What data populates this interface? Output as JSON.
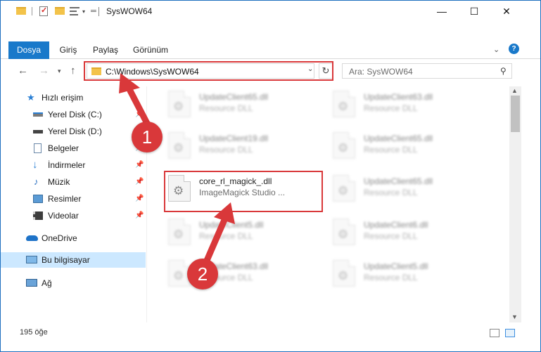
{
  "window": {
    "title": "SysWOW64",
    "controls": {
      "minimize": "—",
      "maximize": "☐",
      "close": "✕"
    }
  },
  "ribbon": {
    "tabs": [
      "Dosya",
      "Giriş",
      "Paylaş",
      "Görünüm"
    ],
    "help": "?"
  },
  "navigation": {
    "address": "C:\\Windows\\SysWOW64",
    "search_placeholder": "Ara: SysWOW64"
  },
  "sidebar": {
    "items": [
      {
        "label": "Hızlı erişim",
        "icon": "star-icon"
      },
      {
        "label": "Yerel Disk (C:)",
        "icon": "drive-c-icon",
        "pinned": true
      },
      {
        "label": "Yerel Disk (D:)",
        "icon": "drive-icon",
        "pinned": true
      },
      {
        "label": "Belgeler",
        "icon": "documents-icon",
        "pinned": true
      },
      {
        "label": "İndirmeler",
        "icon": "download-icon",
        "pinned": true
      },
      {
        "label": "Müzik",
        "icon": "music-icon",
        "pinned": true
      },
      {
        "label": "Resimler",
        "icon": "pictures-icon",
        "pinned": true
      },
      {
        "label": "Videolar",
        "icon": "videos-icon",
        "pinned": true
      },
      {
        "label": "OneDrive",
        "icon": "cloud-icon"
      },
      {
        "label": "Bu bilgisayar",
        "icon": "computer-icon",
        "selected": true
      },
      {
        "label": "Ağ",
        "icon": "network-icon"
      }
    ]
  },
  "files": [
    {
      "name": "UpdateClient65.dll",
      "desc": "Resource DLL",
      "blurred": true
    },
    {
      "name": "UpdateClient63.dll",
      "desc": "Resource DLL",
      "blurred": true
    },
    {
      "name": "UpdateClient19.dll",
      "desc": "Resource DLL",
      "blurred": true
    },
    {
      "name": "UpdateClient65.dll",
      "desc": "Resource DLL",
      "blurred": true
    },
    {
      "name": "core_rl_magick_.dll",
      "desc": "ImageMagick Studio ...",
      "blurred": false
    },
    {
      "name": "UpdateClient65.dll",
      "desc": "Resource DLL",
      "blurred": true
    },
    {
      "name": "UpdateClient5.dll",
      "desc": "Resource DLL",
      "blurred": true
    },
    {
      "name": "UpdateClient6.dll",
      "desc": "Resource DLL",
      "blurred": true
    },
    {
      "name": "UpdateClient63.dll",
      "desc": "Resource DLL",
      "blurred": true
    },
    {
      "name": "UpdateClient5.dll",
      "desc": "Resource DLL",
      "blurred": true
    }
  ],
  "status": {
    "count": "195 öğe"
  },
  "annotations": {
    "marker1": "1",
    "marker2": "2",
    "color": "#d9383a"
  },
  "colors": {
    "accent": "#1979ca",
    "selected": "#cce8ff"
  }
}
